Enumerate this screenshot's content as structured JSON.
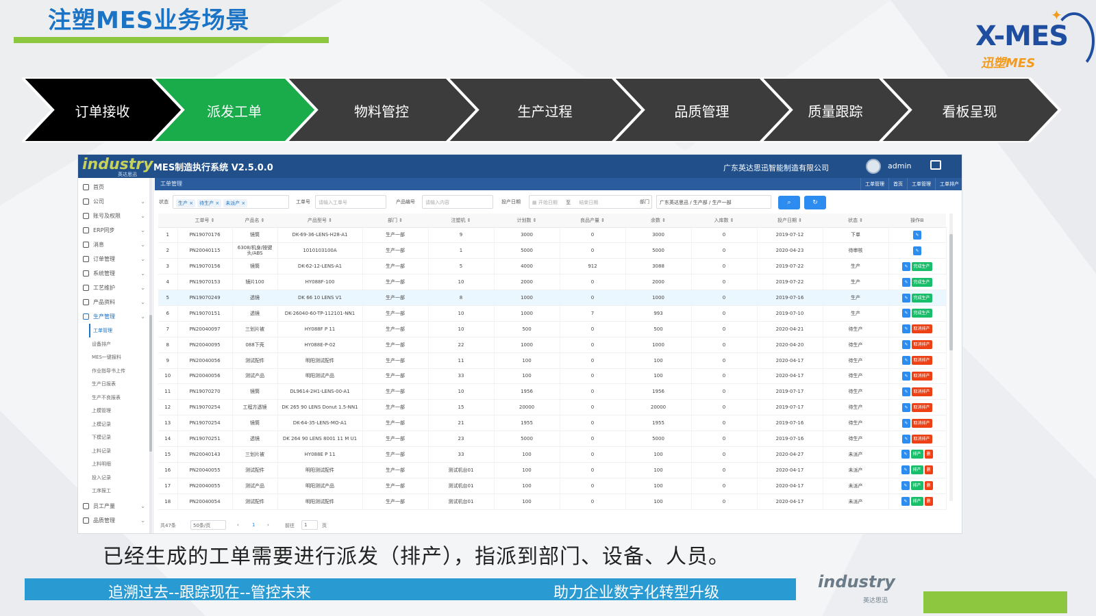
{
  "slide": {
    "title": "注塑MES业务场景",
    "logo_text": "X-MES",
    "logo_sub": "迅塑MES",
    "caption": "已经生成的工单需要进行派发（排产），指派到部门、设备、人员。",
    "footer_left": "追溯过去--跟踪现在--管控未来",
    "footer_right": "助力企业数字化转型升级",
    "footer_logo": "industry",
    "footer_logo_sub": "英达思迅"
  },
  "flow": {
    "steps": [
      {
        "label": "订单接收",
        "color": "#000000"
      },
      {
        "label": "派发工单",
        "color": "#1aab4a"
      },
      {
        "label": "物料管控",
        "color": "#3c3c3c"
      },
      {
        "label": "生产过程",
        "color": "#3c3c3c"
      },
      {
        "label": "品质管理",
        "color": "#3c3c3c"
      },
      {
        "label": "质量跟踪",
        "color": "#3c3c3c"
      },
      {
        "label": "看板呈现",
        "color": "#3c3c3c"
      }
    ]
  },
  "app": {
    "brand": "industry",
    "brand_sub": "英达思迅",
    "name": "MES制造执行系统 V2.5.0.0",
    "company": "广东英达思迅智能制造有限公司",
    "user": "admin",
    "crumb": "工单管理",
    "tabs": [
      "工单管理",
      "首页",
      "工单管理",
      "工单排产"
    ],
    "sidebar": [
      {
        "label": "首页",
        "icon": "home-icon"
      },
      {
        "label": "公司",
        "icon": "bank-icon"
      },
      {
        "label": "账号及权限",
        "icon": "user-icon"
      },
      {
        "label": "ERP同步",
        "icon": "sync-icon"
      },
      {
        "label": "消息",
        "icon": "chat-icon"
      },
      {
        "label": "订单管理",
        "icon": "order-icon"
      },
      {
        "label": "系统管理",
        "icon": "system-icon"
      },
      {
        "label": "工艺维护",
        "icon": "monitor-icon"
      },
      {
        "label": "产品资料",
        "icon": "folder-icon"
      },
      {
        "label": "生产管理",
        "icon": "factory-icon",
        "active": true
      }
    ],
    "sub_items": [
      "工单管理",
      "设备排产",
      "MES一键报料",
      "作业指导书上传",
      "生产日报表",
      "生产不良报表",
      "上模管理",
      "上模记录",
      "下模记录",
      "上料记录",
      "上料明细",
      "投入记录",
      "工序报工"
    ],
    "sidebar_bottom": [
      {
        "label": "员工产量",
        "icon": "staff-icon"
      },
      {
        "label": "品质管理",
        "icon": "quality-icon"
      }
    ],
    "filter": {
      "status_label": "状态",
      "status_chips": [
        "生产",
        "待生产",
        "未派产"
      ],
      "wo_label": "工单号",
      "wo_placeholder": "请输入工单号",
      "product_label": "产品编号",
      "product_placeholder": "请输入内容",
      "date_label": "投产日期",
      "date_start": "开始日期",
      "date_sep": "至",
      "date_end": "结束日期",
      "dept_label": "部门",
      "dept_value": "广东英达思迅 / 生产部 / 生产一部",
      "search_btn": "⌕",
      "refresh_btn": "↻"
    },
    "table": {
      "headers": [
        "",
        "工单号",
        "产品名",
        "产品型号",
        "部门",
        "注塑机",
        "计划数",
        "良品产量",
        "余数",
        "入库数",
        "投产日期",
        "状态",
        "操作"
      ],
      "rows": [
        {
          "no": "1",
          "wo": "PN19070176",
          "name": "镜筒",
          "model": "DK-69-36-LENS-H28-A1",
          "dept": "生产一部",
          "machine": "9",
          "plan": "3000",
          "good": "0",
          "left": "3000",
          "stock": "0",
          "date": "2019-07-12",
          "status": "下单",
          "sc": "st-green",
          "ops": [
            [
              "✎",
              "ab-blue"
            ]
          ]
        },
        {
          "no": "2",
          "wo": "PN20040115",
          "name": "6308/机身/按键头/ABS",
          "model": "1010103100A",
          "dept": "生产一部",
          "machine": "1",
          "plan": "5000",
          "good": "0",
          "left": "5000",
          "stock": "0",
          "date": "2020-04-23",
          "status": "待审核",
          "sc": "st-green",
          "ops": [
            [
              "✎",
              "ab-blue"
            ]
          ]
        },
        {
          "no": "3",
          "wo": "PN19070156",
          "name": "镜筒",
          "model": "DK-62-12-LENS-A1",
          "dept": "生产一部",
          "machine": "5",
          "plan": "4000",
          "good": "912",
          "left": "3088",
          "stock": "0",
          "date": "2019-07-22",
          "status": "生产",
          "sc": "st-green",
          "ops": [
            [
              "✎",
              "ab-blue"
            ],
            [
              "完成生产",
              "ab-green"
            ]
          ]
        },
        {
          "no": "4",
          "wo": "PN19070153",
          "name": "镜片100",
          "model": "HY088F-100",
          "dept": "生产一部",
          "machine": "10",
          "plan": "2000",
          "good": "0",
          "left": "2000",
          "stock": "0",
          "date": "2019-07-22",
          "status": "生产",
          "sc": "st-green",
          "ops": [
            [
              "✎",
              "ab-blue"
            ],
            [
              "完成生产",
              "ab-green"
            ]
          ]
        },
        {
          "no": "5",
          "wo": "PN19070249",
          "name": "透镜",
          "model": "DK 66 10 LENS V1",
          "dept": "生产一部",
          "machine": "8",
          "plan": "1000",
          "good": "0",
          "left": "1000",
          "stock": "0",
          "date": "2019-07-16",
          "status": "生产",
          "sc": "st-green",
          "ops": [
            [
              "✎",
              "ab-blue"
            ],
            [
              "完成生产",
              "ab-green"
            ]
          ],
          "hl": true
        },
        {
          "no": "6",
          "wo": "PN19070151",
          "name": "透镜",
          "model": "DK-26040-60-TP-112101-NN1",
          "dept": "生产一部",
          "machine": "10",
          "plan": "1000",
          "good": "7",
          "left": "993",
          "stock": "0",
          "date": "2019-07-10",
          "status": "生产",
          "sc": "st-green",
          "ops": [
            [
              "✎",
              "ab-blue"
            ],
            [
              "完成生产",
              "ab-green"
            ]
          ]
        },
        {
          "no": "7",
          "wo": "PN20040097",
          "name": "三划片被",
          "model": "HY088F P 11",
          "dept": "生产一部",
          "machine": "10",
          "plan": "500",
          "good": "0",
          "left": "500",
          "stock": "0",
          "date": "2020-04-21",
          "status": "待生产",
          "sc": "st-yellow",
          "ops": [
            [
              "✎",
              "ab-blue"
            ],
            [
              "取消排产",
              "ab-red"
            ]
          ]
        },
        {
          "no": "8",
          "wo": "PN20040095",
          "name": "088下壳",
          "model": "HY088E-P-02",
          "dept": "生产一部",
          "machine": "22",
          "plan": "1000",
          "good": "0",
          "left": "1000",
          "stock": "0",
          "date": "2020-04-20",
          "status": "待生产",
          "sc": "st-yellow",
          "ops": [
            [
              "✎",
              "ab-blue"
            ],
            [
              "取消排产",
              "ab-red"
            ]
          ]
        },
        {
          "no": "9",
          "wo": "PN20040056",
          "name": "测试配件",
          "model": "明阳测试配件",
          "dept": "生产一部",
          "machine": "11",
          "plan": "100",
          "good": "0",
          "left": "100",
          "stock": "0",
          "date": "2020-04-17",
          "status": "待生产",
          "sc": "st-yellow",
          "ops": [
            [
              "✎",
              "ab-blue"
            ],
            [
              "取消排产",
              "ab-red"
            ]
          ]
        },
        {
          "no": "10",
          "wo": "PN20040056",
          "name": "测试产品",
          "model": "明阳测试产品",
          "dept": "生产一部",
          "machine": "33",
          "plan": "100",
          "good": "0",
          "left": "100",
          "stock": "0",
          "date": "2020-04-17",
          "status": "待生产",
          "sc": "st-yellow",
          "ops": [
            [
              "✎",
              "ab-blue"
            ],
            [
              "取消排产",
              "ab-red"
            ]
          ]
        },
        {
          "no": "11",
          "wo": "PN19070270",
          "name": "镜筒",
          "model": "DL9614-2H1-LENS-00-A1",
          "dept": "生产一部",
          "machine": "10",
          "plan": "1956",
          "good": "0",
          "left": "1956",
          "stock": "0",
          "date": "2019-07-17",
          "status": "待生产",
          "sc": "st-yellow",
          "ops": [
            [
              "✎",
              "ab-blue"
            ],
            [
              "取消排产",
              "ab-red"
            ]
          ]
        },
        {
          "no": "12",
          "wo": "PN19070254",
          "name": "工程方透镜",
          "model": "DK 265 90 LENS Donut 1.5-NN1",
          "dept": "生产一部",
          "machine": "15",
          "plan": "20000",
          "good": "0",
          "left": "20000",
          "stock": "0",
          "date": "2019-07-17",
          "status": "待生产",
          "sc": "st-yellow",
          "ops": [
            [
              "✎",
              "ab-blue"
            ],
            [
              "取消排产",
              "ab-red"
            ]
          ]
        },
        {
          "no": "13",
          "wo": "PN19070254",
          "name": "镜筒",
          "model": "DK-64-35-LENS-MO-A1",
          "dept": "生产一部",
          "machine": "21",
          "plan": "1955",
          "good": "0",
          "left": "1955",
          "stock": "0",
          "date": "2019-07-16",
          "status": "待生产",
          "sc": "st-yellow",
          "ops": [
            [
              "✎",
              "ab-blue"
            ],
            [
              "取消排产",
              "ab-red"
            ]
          ]
        },
        {
          "no": "14",
          "wo": "PN19070251",
          "name": "透镜",
          "model": "DK 264 90 LENS 8001 11 M U1",
          "dept": "生产一部",
          "machine": "23",
          "plan": "5000",
          "good": "0",
          "left": "5000",
          "stock": "0",
          "date": "2019-07-16",
          "status": "待生产",
          "sc": "st-yellow",
          "ops": [
            [
              "✎",
              "ab-blue"
            ],
            [
              "取消排产",
              "ab-red"
            ]
          ]
        },
        {
          "no": "15",
          "wo": "PN20040143",
          "name": "三划片被",
          "model": "HY088E P 11",
          "dept": "生产一部",
          "machine": "33",
          "plan": "100",
          "good": "0",
          "left": "100",
          "stock": "0",
          "date": "2020-04-27",
          "status": "未派产",
          "sc": "st-blue",
          "ops": [
            [
              "✎",
              "ab-blue"
            ],
            [
              "排产",
              "ab-green"
            ],
            [
              "删",
              "ab-red"
            ]
          ]
        },
        {
          "no": "16",
          "wo": "PN20040055",
          "name": "测试配件",
          "model": "明阳测试配件",
          "dept": "生产一部",
          "machine": "测试机台01",
          "plan": "100",
          "good": "0",
          "left": "100",
          "stock": "0",
          "date": "2020-04-17",
          "status": "未派产",
          "sc": "st-blue",
          "ops": [
            [
              "✎",
              "ab-blue"
            ],
            [
              "排产",
              "ab-green"
            ],
            [
              "删",
              "ab-red"
            ]
          ]
        },
        {
          "no": "17",
          "wo": "PN20040055",
          "name": "测试产品",
          "model": "明阳测试产品",
          "dept": "生产一部",
          "machine": "测试机台01",
          "plan": "100",
          "good": "0",
          "left": "100",
          "stock": "0",
          "date": "2020-04-17",
          "status": "未派产",
          "sc": "st-blue",
          "ops": [
            [
              "✎",
              "ab-blue"
            ],
            [
              "排产",
              "ab-green"
            ],
            [
              "删",
              "ab-red"
            ]
          ]
        },
        {
          "no": "18",
          "wo": "PN20040054",
          "name": "测试配件",
          "model": "明阳测试配件",
          "dept": "生产一部",
          "machine": "测试机台01",
          "plan": "100",
          "good": "0",
          "left": "100",
          "stock": "0",
          "date": "2020-04-17",
          "status": "未派产",
          "sc": "st-blue",
          "ops": [
            [
              "✎",
              "ab-blue"
            ],
            [
              "排产",
              "ab-green"
            ],
            [
              "删",
              "ab-red"
            ]
          ]
        }
      ]
    },
    "pager": {
      "total": "共47条",
      "per_page": "50条/页",
      "prev": "‹",
      "page": "1",
      "next": "›",
      "goto": "前往",
      "goto_page": "1",
      "goto_suffix": "页"
    }
  }
}
